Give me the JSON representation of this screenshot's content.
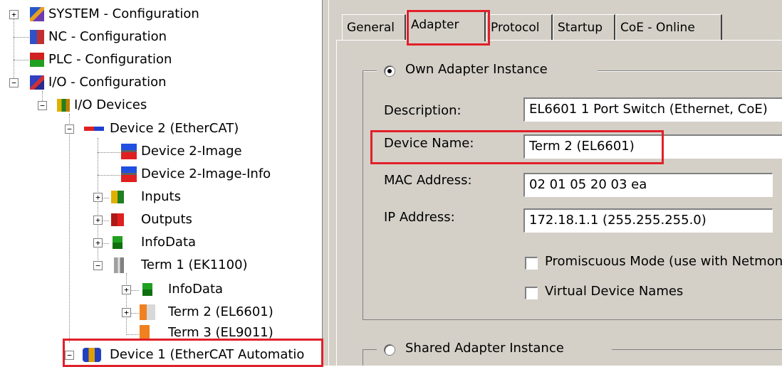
{
  "tree": {
    "items": [
      {
        "label": "SYSTEM - Configuration",
        "expander": "+",
        "icon": "system-config-icon"
      },
      {
        "label": "NC - Configuration",
        "icon": "nc-config-icon"
      },
      {
        "label": "PLC - Configuration",
        "icon": "plc-config-icon"
      },
      {
        "label": "I/O - Configuration",
        "expander": "−",
        "icon": "io-config-icon"
      },
      {
        "label": "I/O Devices",
        "expander": "−",
        "icon": "io-devices-icon"
      },
      {
        "label": "Device 2 (EtherCAT)",
        "expander": "−",
        "icon": "ethercat-device-icon"
      },
      {
        "label": "Device 2-Image",
        "icon": "device-image-icon"
      },
      {
        "label": "Device 2-Image-Info",
        "icon": "device-image-info-icon"
      },
      {
        "label": "Inputs",
        "expander": "+",
        "icon": "inputs-icon"
      },
      {
        "label": "Outputs",
        "expander": "+",
        "icon": "outputs-icon"
      },
      {
        "label": "InfoData",
        "expander": "+",
        "icon": "infodata-icon"
      },
      {
        "label": "Term 1 (EK1100)",
        "expander": "−",
        "icon": "coupler-terminal-icon"
      },
      {
        "label": "InfoData",
        "expander": "+",
        "icon": "infodata-icon"
      },
      {
        "label": "Term 2 (EL6601)",
        "expander": "+",
        "icon": "terminal-icon"
      },
      {
        "label": "Term 3 (EL9011)",
        "icon": "end-terminal-icon"
      },
      {
        "label": "Device 1 (EtherCAT Automatio",
        "expander": "−",
        "icon": "automation-device-icon"
      }
    ]
  },
  "tabs": [
    {
      "label": "General"
    },
    {
      "label": "Adapter"
    },
    {
      "label": "Protocol"
    },
    {
      "label": "Startup"
    },
    {
      "label": "CoE - Online"
    }
  ],
  "adapter": {
    "own_instance_label": "Own Adapter Instance",
    "own_instance_selected": true,
    "description_label": "Description:",
    "description_value": "EL6601 1 Port Switch (Ethernet, CoE)",
    "device_name_label": "Device Name:",
    "device_name_value": "Term 2 (EL6601)",
    "mac_label": "MAC Address:",
    "mac_value": "02 01 05 20 03 ea",
    "ip_label": "IP Address:",
    "ip_value": "172.18.1.1 (255.255.255.0)",
    "promiscuous_label": "Promiscuous Mode (use with Netmon",
    "promiscuous_checked": false,
    "virtual_names_label": "Virtual Device Names",
    "virtual_names_checked": false,
    "shared_instance_label": "Shared Adapter Instance",
    "shared_instance_selected": false
  },
  "colors": {
    "highlight_red": "#e0202a",
    "panel_bg": "#d4d0c8"
  }
}
